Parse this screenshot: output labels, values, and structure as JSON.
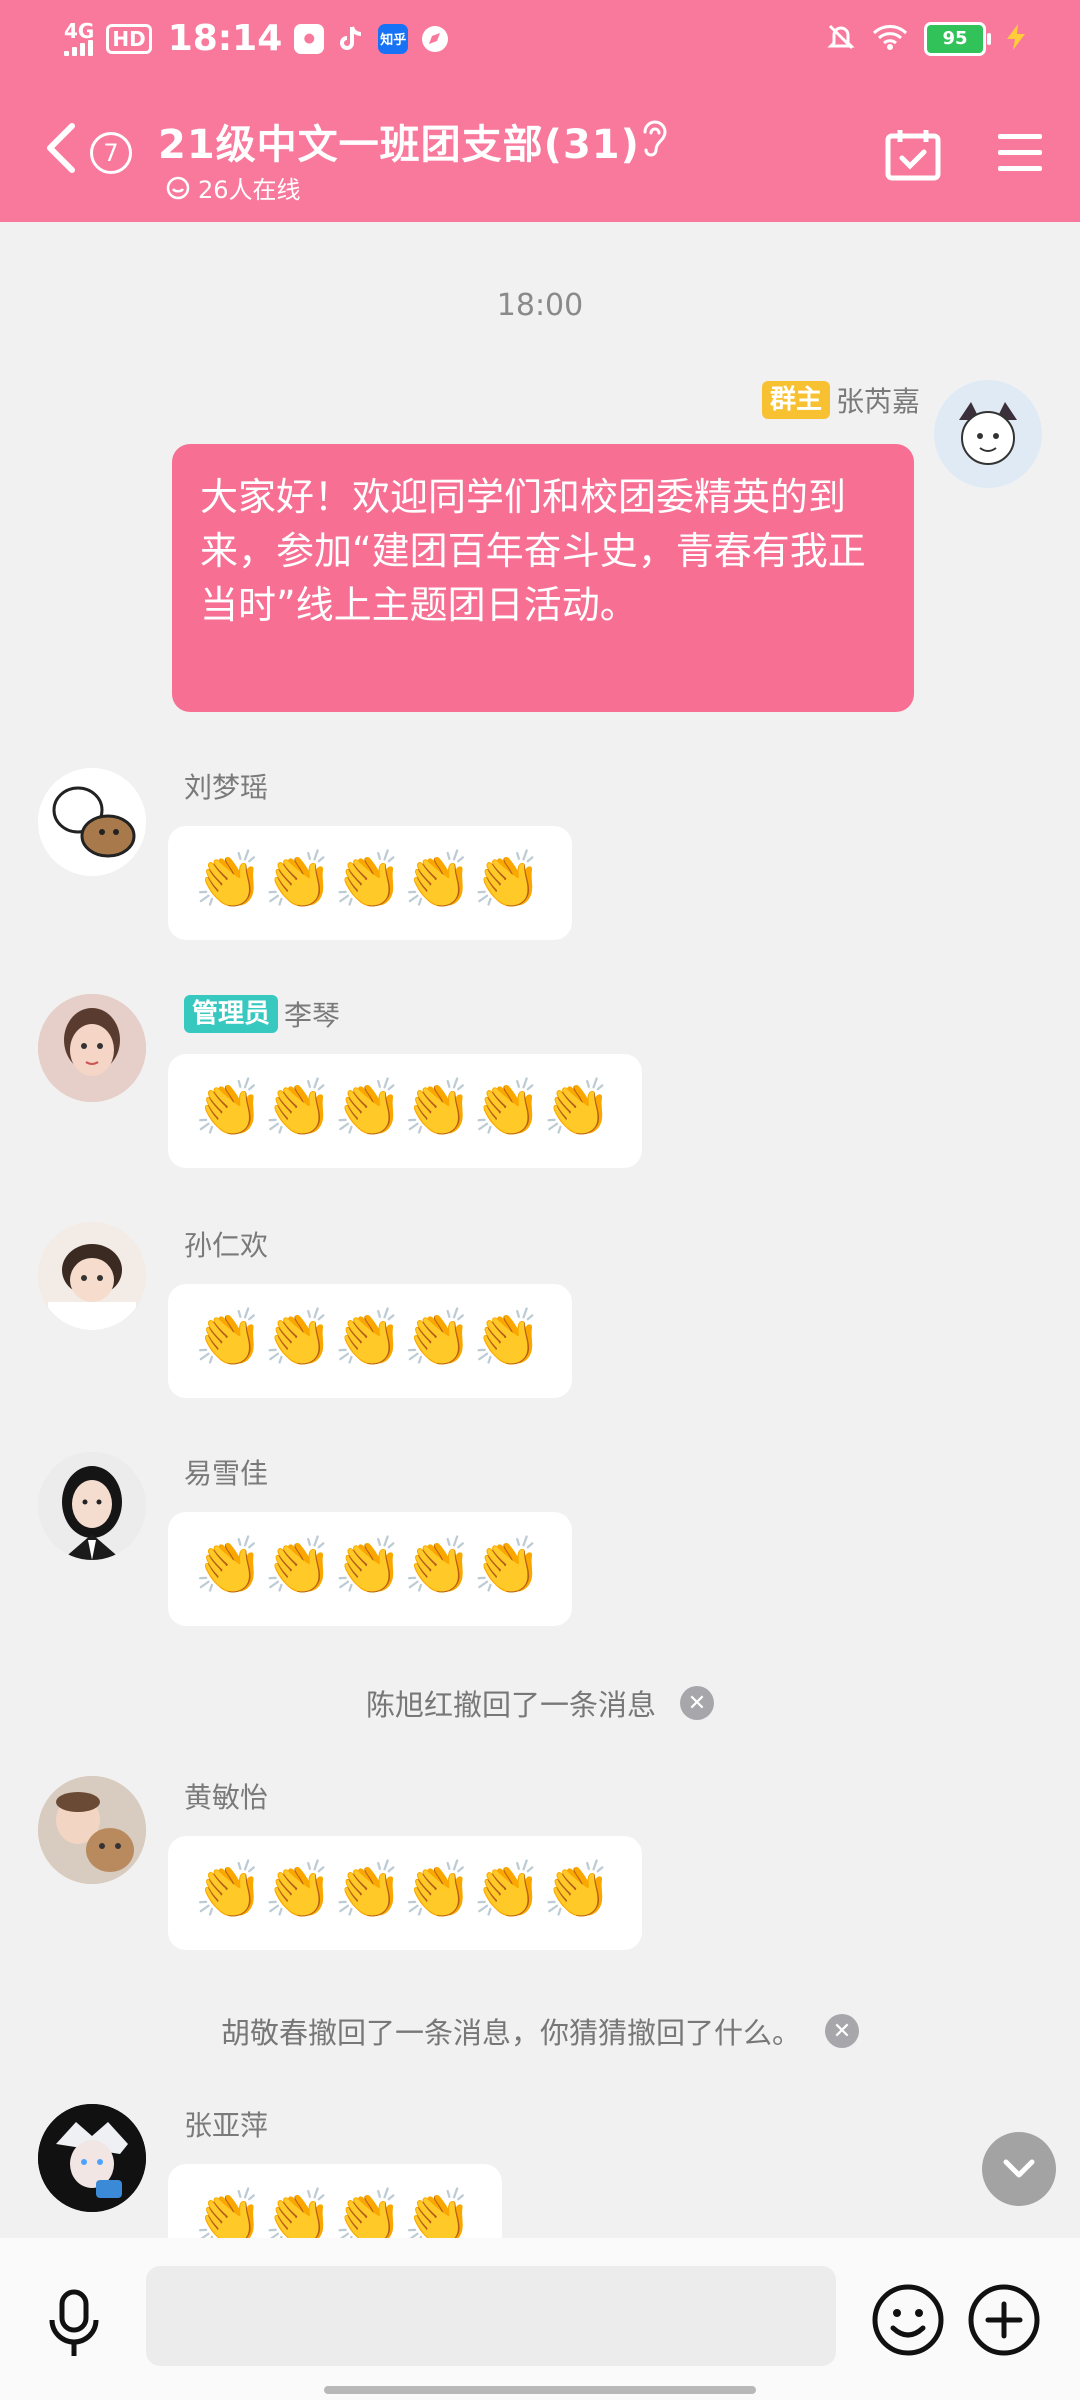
{
  "status_bar": {
    "network": "4G",
    "hd": "HD",
    "time": "18:14",
    "app_icons": [
      "weibo-lite-icon",
      "tiktok-icon",
      "zhihu-icon",
      "compass-icon"
    ],
    "zhihu_label": "知乎",
    "battery": "95"
  },
  "header": {
    "back_badge": "7",
    "title": "21级中文一班团支部(31)",
    "online": "26人在线"
  },
  "chat": {
    "time_divider": "18:00",
    "messages": [
      {
        "sender": "张芮嘉",
        "role": "群主",
        "role_color": "#f7c132",
        "side": "right",
        "text": "大家好！欢迎同学们和校团委精英的到来，参加“建团百年奋斗史，青春有我正当时”线上主题团日活动。"
      },
      {
        "sender": "刘梦瑶",
        "role": "",
        "side": "left",
        "text": "👏👏👏👏👏"
      },
      {
        "sender": "李琴",
        "role": "管理员",
        "role_color": "#37c8c0",
        "side": "left",
        "text": "👏👏👏👏👏👏"
      },
      {
        "sender": "孙仁欢",
        "role": "",
        "side": "left",
        "text": "👏👏👏👏👏"
      },
      {
        "sender": "易雪佳",
        "role": "",
        "side": "left",
        "text": "👏👏👏👏👏"
      },
      {
        "sender": "黄敏怡",
        "role": "",
        "side": "left",
        "text": "👏👏👏👏👏👏"
      },
      {
        "sender": "张亚萍",
        "role": "",
        "side": "left",
        "text": "👏👏👏👏"
      }
    ],
    "recall_1": "陈旭红撤回了一条消息",
    "recall_2": "胡敬春撤回了一条消息，你猜猜撤回了什么。"
  },
  "colors": {
    "header_bg": "#f9799c",
    "owner_bubble": "#f76f93",
    "page_bg": "#f1f1f1"
  }
}
